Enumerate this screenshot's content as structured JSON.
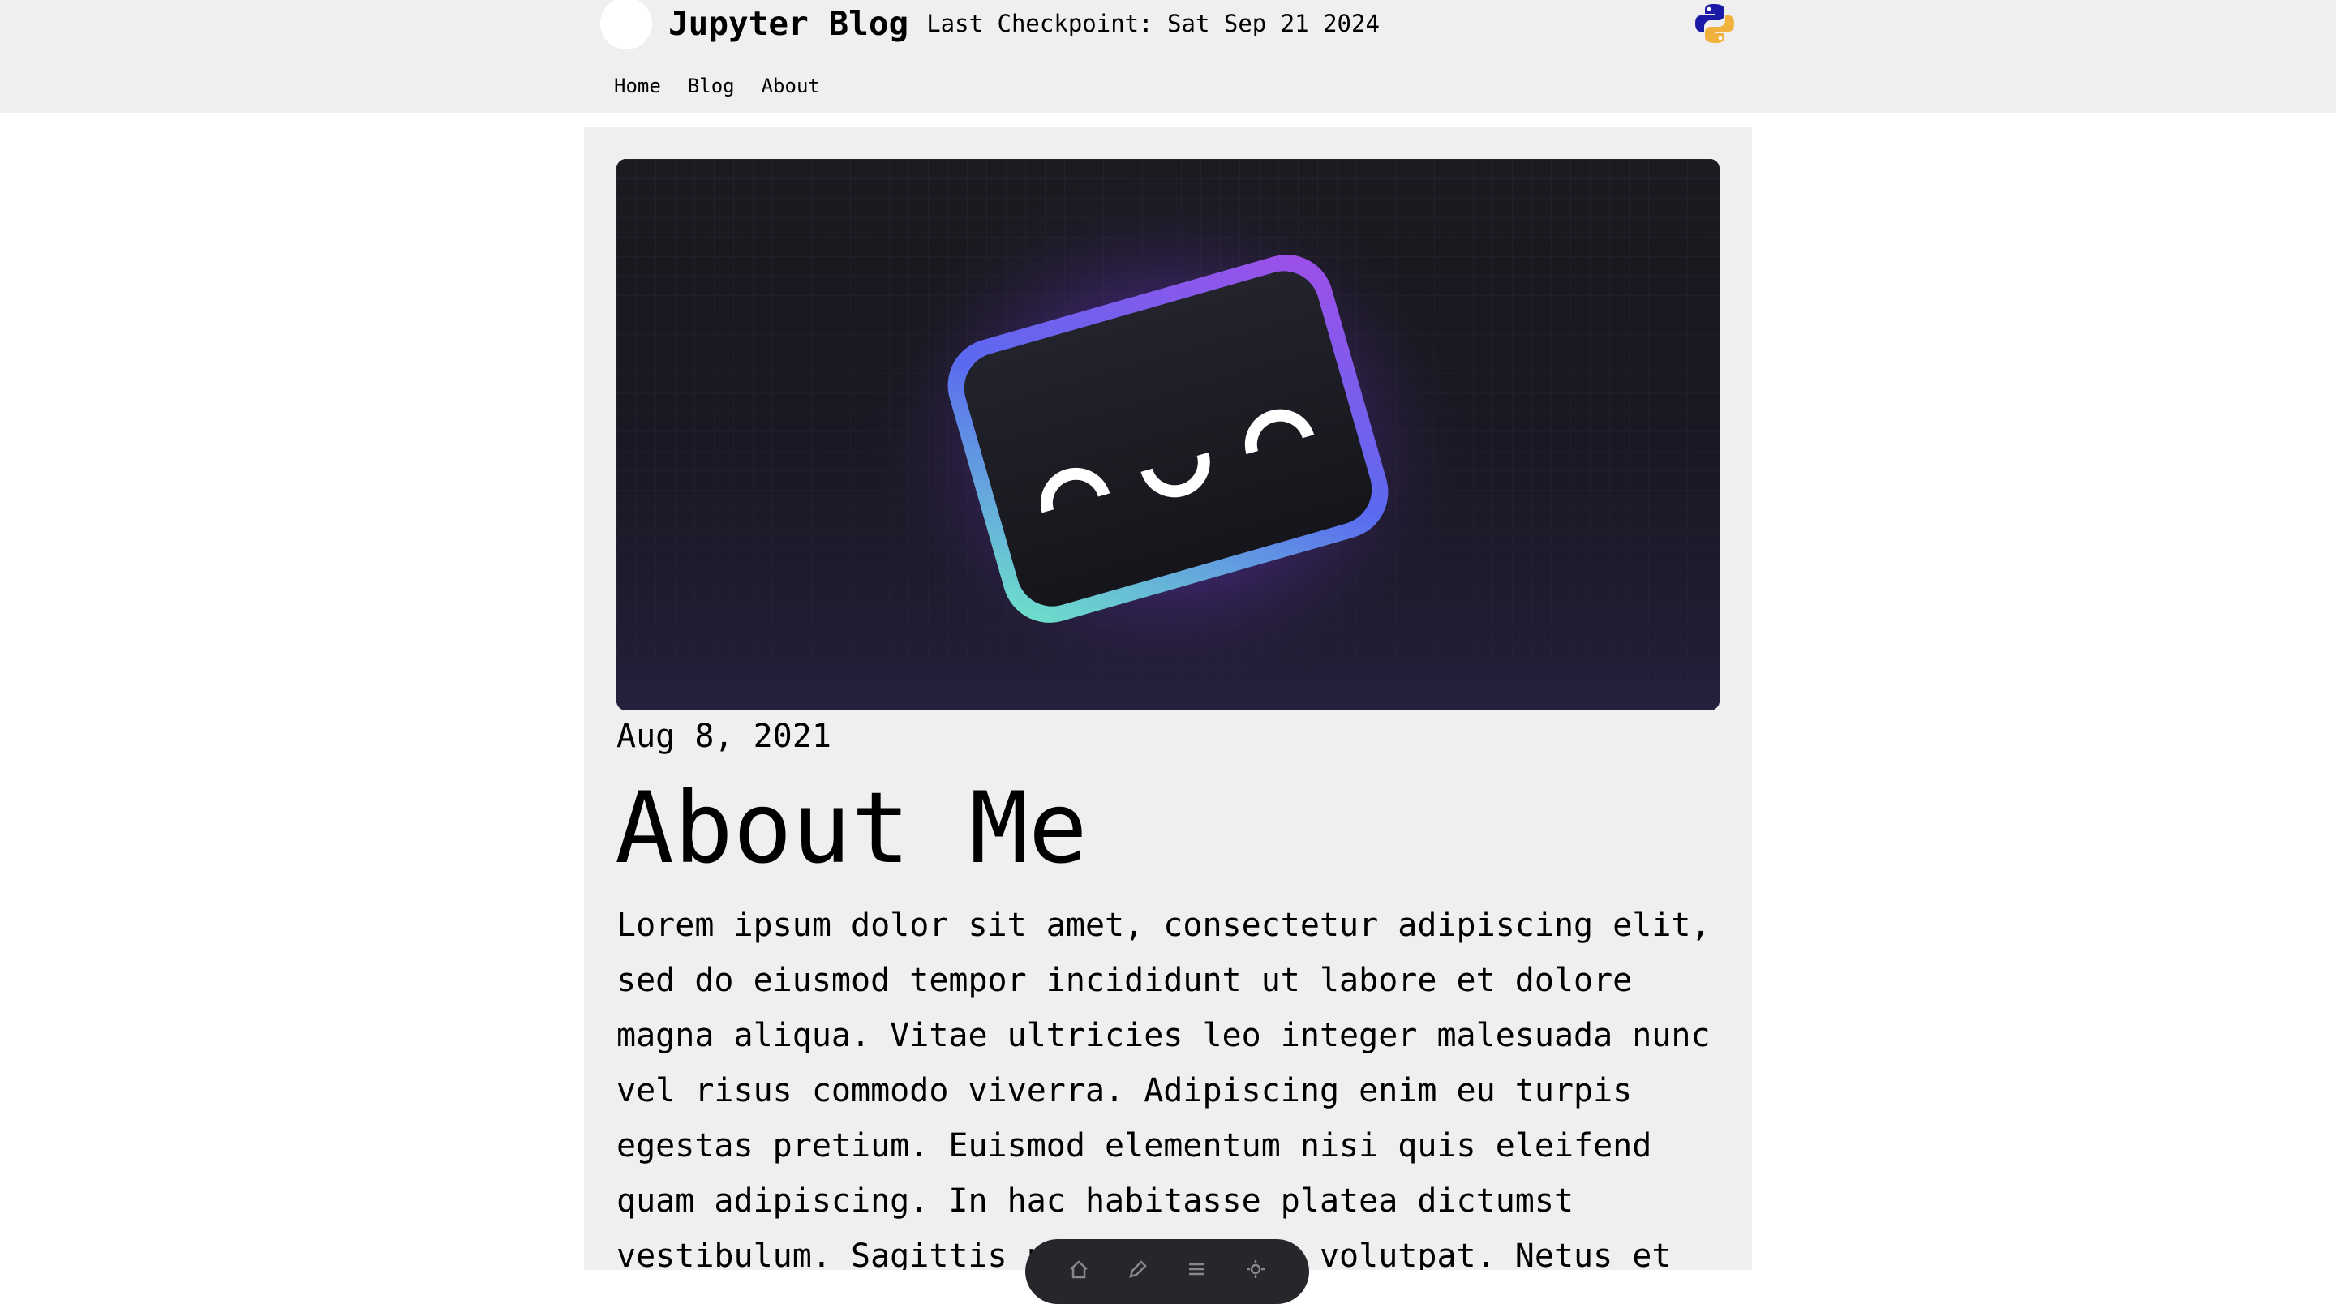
{
  "header": {
    "site_title": "Jupyter Blog",
    "checkpoint": "Last Checkpoint: Sat Sep 21 2024",
    "nav": [
      {
        "label": "Home"
      },
      {
        "label": "Blog"
      },
      {
        "label": "About"
      }
    ],
    "logo_icon": "python-logo-icon"
  },
  "post": {
    "hero_image": "smiling-rounded-rectangle-gradient-illustration",
    "date": "Aug 8, 2021",
    "title": "About Me",
    "body": "Lorem ipsum dolor sit amet, consectetur adipiscing elit, sed do eiusmod tempor incididunt ut labore et dolore magna aliqua. Vitae ultricies leo integer malesuada nunc vel risus commodo viverra. Adipiscing enim eu turpis egestas pretium. Euismod elementum nisi quis eleifend quam adipiscing. In hac habitasse platea dictumst vestibulum. Sagittis purus sit amet volutpat. Netus et"
  },
  "toolbar": {
    "icons": [
      "home-icon",
      "edit-icon",
      "list-icon",
      "settings-icon"
    ]
  },
  "colors": {
    "header_bg": "#efefef",
    "article_bg": "#efefef",
    "hero_bg": "#1c1b22",
    "glow": "#7b3fd6",
    "python_blue": "#1a1aa6",
    "python_yellow": "#f0b23c"
  }
}
